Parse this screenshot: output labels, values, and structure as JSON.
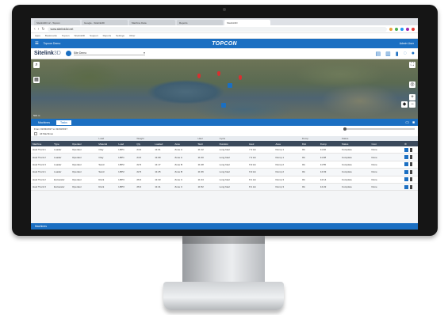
{
  "browser": {
    "tabs": [
      {
        "label": "Sitelink3D v2 - Topcon",
        "active": false
      },
      {
        "label": "Google - Sitelink3D",
        "active": false
      },
      {
        "label": "Machine Data",
        "active": false
      },
      {
        "label": "Reports",
        "active": false
      },
      {
        "label": "Sitelink3D",
        "active": true
      }
    ],
    "url": "www.sitelink3d.net",
    "bookmarks": [
      "Apps",
      "Bookmarks",
      "Topcon",
      "Sitelink3D",
      "Support",
      "Reports",
      "Settings",
      "Other"
    ]
  },
  "app": {
    "org_label": "Topcon Demo",
    "brand": "TOPCON",
    "user_label": "Admin User"
  },
  "subheader": {
    "logo_main": "Sitelink",
    "logo_suffix": "3D",
    "site_selector": "Site Demo",
    "site_selector_caret": "▾"
  },
  "map": {
    "scale_label": "500 m",
    "zoom_in": "+",
    "zoom_out": "−"
  },
  "panel": {
    "tabs": [
      {
        "label": "Machines",
        "active": false
      },
      {
        "label": "Tasks",
        "active": true
      }
    ]
  },
  "filters": {
    "date_range": "From 01/03/2017 to 31/03/2017",
    "search_label": "All Machines"
  },
  "table": {
    "groups": [
      "",
      "",
      "",
      "Load",
      "",
      "Weight",
      "",
      "",
      "Haul",
      "Cycle",
      "",
      "",
      "Dump",
      "",
      "Status",
      ""
    ],
    "columns": [
      "Machine",
      "Type",
      "Operator",
      "Material",
      "Load",
      "Qty",
      "Loaded",
      "Area",
      "Start",
      "Duration",
      "Haul",
      "Area",
      "Dist",
      "Dump",
      "Status",
      "Cost"
    ],
    "rows": [
      [
        "Haul Truck 1",
        "Loader",
        "Operator",
        "Clay",
        "LBP1",
        "24.0",
        "11:01",
        "Zone A",
        "11:12",
        "Long haul",
        "7.2 km",
        "Dump 1",
        "Ok",
        "11:40",
        "Complete",
        "Done"
      ],
      [
        "Haul Truck 2",
        "Loader",
        "Operator",
        "Clay",
        "LBP1",
        "24.0",
        "11:09",
        "Zone A",
        "11:20",
        "Long haul",
        "7.2 km",
        "Dump 1",
        "Ok",
        "11:48",
        "Complete",
        "Done"
      ],
      [
        "Haul Truck 3",
        "Loader",
        "Operator",
        "Sand",
        "LBP2",
        "22.5",
        "11:17",
        "Zone B",
        "11:28",
        "Long haul",
        "6.9 km",
        "Dump 2",
        "Ok",
        "11:55",
        "Complete",
        "Done"
      ],
      [
        "Haul Truck 1",
        "Loader",
        "Operator",
        "Sand",
        "LBP2",
        "22.5",
        "11:25",
        "Zone B",
        "11:36",
        "Long haul",
        "6.9 km",
        "Dump 2",
        "Ok",
        "12:03",
        "Complete",
        "Done"
      ],
      [
        "Haul Truck 2",
        "Excavator",
        "Operator",
        "Rock",
        "LBP3",
        "26.0",
        "11:33",
        "Zone C",
        "11:44",
        "Long haul",
        "8.1 km",
        "Dump 3",
        "Ok",
        "12:14",
        "Complete",
        "Done"
      ],
      [
        "Haul Truck 3",
        "Excavator",
        "Operator",
        "Rock",
        "LBP3",
        "26.0",
        "11:41",
        "Zone C",
        "11:52",
        "Long haul",
        "8.1 km",
        "Dump 3",
        "Ok",
        "12:22",
        "Complete",
        "Done"
      ]
    ]
  },
  "footer": {
    "label": "Machines"
  }
}
